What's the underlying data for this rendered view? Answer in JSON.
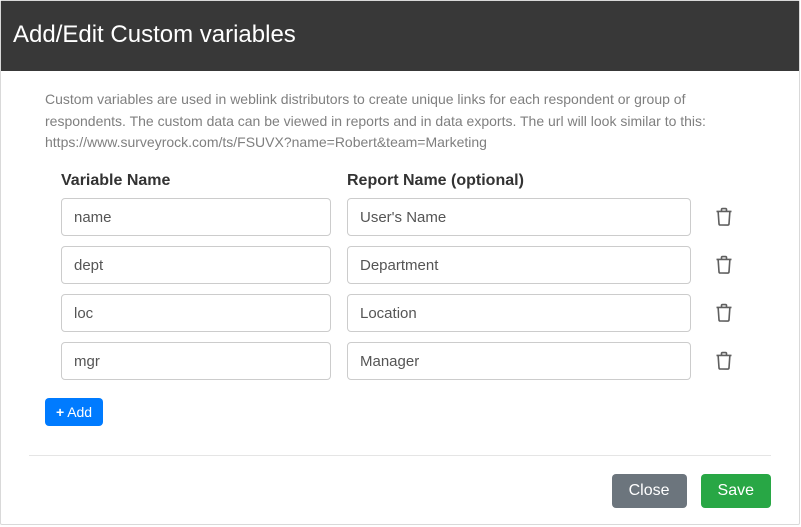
{
  "modal": {
    "title": "Add/Edit Custom variables",
    "description": "Custom variables are used in weblink distributors to create unique links for each respondent or group of respondents. The custom data can be viewed in reports and in data exports. The url will look similar to this: https://www.surveyrock.com/ts/FSUVX?name=Robert&team=Marketing",
    "columns": {
      "variable": "Variable Name",
      "report": "Report Name (optional)"
    },
    "rows": [
      {
        "variable": "name",
        "report": "User's Name"
      },
      {
        "variable": "dept",
        "report": "Department"
      },
      {
        "variable": "loc",
        "report": "Location"
      },
      {
        "variable": "mgr",
        "report": "Manager"
      }
    ],
    "add_label": "Add",
    "close_label": "Close",
    "save_label": "Save"
  }
}
